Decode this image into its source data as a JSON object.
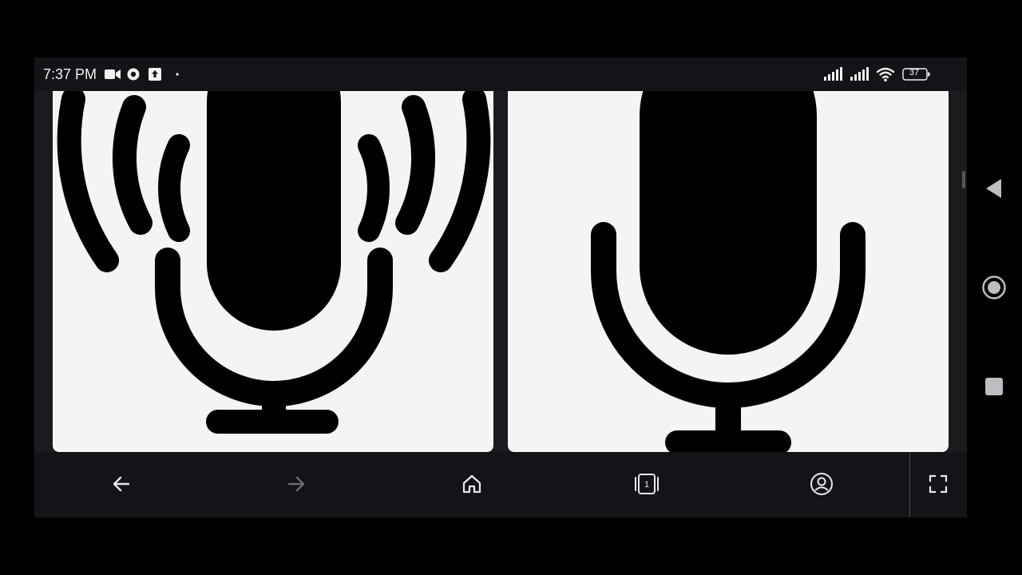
{
  "status_bar": {
    "time": "7:37 PM",
    "battery_level": "37",
    "left_icons": [
      "video-camera-icon",
      "chat-bubble-icon",
      "upload-icon",
      "dot-icon"
    ],
    "right_icons": [
      "signal-bars-icon",
      "signal-bars-icon",
      "wifi-icon",
      "battery-icon"
    ]
  },
  "content": {
    "tiles": [
      {
        "subject": "microphone-with-sound-waves-icon"
      },
      {
        "subject": "microphone-icon"
      }
    ]
  },
  "toolbar": {
    "buttons": [
      "back-arrow-icon",
      "forward-arrow-icon",
      "home-icon",
      "tab-switcher-icon",
      "account-icon",
      "fullscreen-icon"
    ],
    "tab_count": "1",
    "forward_enabled": false
  },
  "nav_bar": {
    "buttons": [
      "back-triangle-icon",
      "home-circle-icon",
      "recents-square-icon"
    ]
  },
  "colors": {
    "background": "#000000",
    "chrome": "#141418",
    "tile_background": "#f4f4f4",
    "icon_light": "#e8e8ea",
    "icon_disabled": "#6a6a70",
    "nav_icon": "#bdbdc2"
  }
}
